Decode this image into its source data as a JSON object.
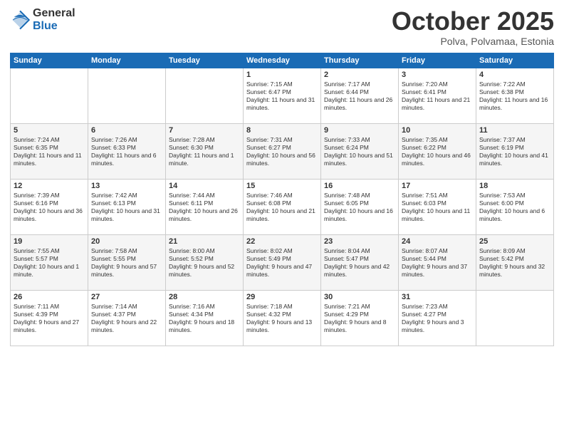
{
  "logo": {
    "general": "General",
    "blue": "Blue"
  },
  "title": "October 2025",
  "location": "Polva, Polvamaa, Estonia",
  "days_of_week": [
    "Sunday",
    "Monday",
    "Tuesday",
    "Wednesday",
    "Thursday",
    "Friday",
    "Saturday"
  ],
  "weeks": [
    [
      {
        "day": "",
        "info": ""
      },
      {
        "day": "",
        "info": ""
      },
      {
        "day": "",
        "info": ""
      },
      {
        "day": "1",
        "sunrise": "Sunrise: 7:15 AM",
        "sunset": "Sunset: 6:47 PM",
        "daylight": "Daylight: 11 hours and 31 minutes."
      },
      {
        "day": "2",
        "sunrise": "Sunrise: 7:17 AM",
        "sunset": "Sunset: 6:44 PM",
        "daylight": "Daylight: 11 hours and 26 minutes."
      },
      {
        "day": "3",
        "sunrise": "Sunrise: 7:20 AM",
        "sunset": "Sunset: 6:41 PM",
        "daylight": "Daylight: 11 hours and 21 minutes."
      },
      {
        "day": "4",
        "sunrise": "Sunrise: 7:22 AM",
        "sunset": "Sunset: 6:38 PM",
        "daylight": "Daylight: 11 hours and 16 minutes."
      }
    ],
    [
      {
        "day": "5",
        "sunrise": "Sunrise: 7:24 AM",
        "sunset": "Sunset: 6:35 PM",
        "daylight": "Daylight: 11 hours and 11 minutes."
      },
      {
        "day": "6",
        "sunrise": "Sunrise: 7:26 AM",
        "sunset": "Sunset: 6:33 PM",
        "daylight": "Daylight: 11 hours and 6 minutes."
      },
      {
        "day": "7",
        "sunrise": "Sunrise: 7:28 AM",
        "sunset": "Sunset: 6:30 PM",
        "daylight": "Daylight: 11 hours and 1 minute."
      },
      {
        "day": "8",
        "sunrise": "Sunrise: 7:31 AM",
        "sunset": "Sunset: 6:27 PM",
        "daylight": "Daylight: 10 hours and 56 minutes."
      },
      {
        "day": "9",
        "sunrise": "Sunrise: 7:33 AM",
        "sunset": "Sunset: 6:24 PM",
        "daylight": "Daylight: 10 hours and 51 minutes."
      },
      {
        "day": "10",
        "sunrise": "Sunrise: 7:35 AM",
        "sunset": "Sunset: 6:22 PM",
        "daylight": "Daylight: 10 hours and 46 minutes."
      },
      {
        "day": "11",
        "sunrise": "Sunrise: 7:37 AM",
        "sunset": "Sunset: 6:19 PM",
        "daylight": "Daylight: 10 hours and 41 minutes."
      }
    ],
    [
      {
        "day": "12",
        "sunrise": "Sunrise: 7:39 AM",
        "sunset": "Sunset: 6:16 PM",
        "daylight": "Daylight: 10 hours and 36 minutes."
      },
      {
        "day": "13",
        "sunrise": "Sunrise: 7:42 AM",
        "sunset": "Sunset: 6:13 PM",
        "daylight": "Daylight: 10 hours and 31 minutes."
      },
      {
        "day": "14",
        "sunrise": "Sunrise: 7:44 AM",
        "sunset": "Sunset: 6:11 PM",
        "daylight": "Daylight: 10 hours and 26 minutes."
      },
      {
        "day": "15",
        "sunrise": "Sunrise: 7:46 AM",
        "sunset": "Sunset: 6:08 PM",
        "daylight": "Daylight: 10 hours and 21 minutes."
      },
      {
        "day": "16",
        "sunrise": "Sunrise: 7:48 AM",
        "sunset": "Sunset: 6:05 PM",
        "daylight": "Daylight: 10 hours and 16 minutes."
      },
      {
        "day": "17",
        "sunrise": "Sunrise: 7:51 AM",
        "sunset": "Sunset: 6:03 PM",
        "daylight": "Daylight: 10 hours and 11 minutes."
      },
      {
        "day": "18",
        "sunrise": "Sunrise: 7:53 AM",
        "sunset": "Sunset: 6:00 PM",
        "daylight": "Daylight: 10 hours and 6 minutes."
      }
    ],
    [
      {
        "day": "19",
        "sunrise": "Sunrise: 7:55 AM",
        "sunset": "Sunset: 5:57 PM",
        "daylight": "Daylight: 10 hours and 1 minute."
      },
      {
        "day": "20",
        "sunrise": "Sunrise: 7:58 AM",
        "sunset": "Sunset: 5:55 PM",
        "daylight": "Daylight: 9 hours and 57 minutes."
      },
      {
        "day": "21",
        "sunrise": "Sunrise: 8:00 AM",
        "sunset": "Sunset: 5:52 PM",
        "daylight": "Daylight: 9 hours and 52 minutes."
      },
      {
        "day": "22",
        "sunrise": "Sunrise: 8:02 AM",
        "sunset": "Sunset: 5:49 PM",
        "daylight": "Daylight: 9 hours and 47 minutes."
      },
      {
        "day": "23",
        "sunrise": "Sunrise: 8:04 AM",
        "sunset": "Sunset: 5:47 PM",
        "daylight": "Daylight: 9 hours and 42 minutes."
      },
      {
        "day": "24",
        "sunrise": "Sunrise: 8:07 AM",
        "sunset": "Sunset: 5:44 PM",
        "daylight": "Daylight: 9 hours and 37 minutes."
      },
      {
        "day": "25",
        "sunrise": "Sunrise: 8:09 AM",
        "sunset": "Sunset: 5:42 PM",
        "daylight": "Daylight: 9 hours and 32 minutes."
      }
    ],
    [
      {
        "day": "26",
        "sunrise": "Sunrise: 7:11 AM",
        "sunset": "Sunset: 4:39 PM",
        "daylight": "Daylight: 9 hours and 27 minutes."
      },
      {
        "day": "27",
        "sunrise": "Sunrise: 7:14 AM",
        "sunset": "Sunset: 4:37 PM",
        "daylight": "Daylight: 9 hours and 22 minutes."
      },
      {
        "day": "28",
        "sunrise": "Sunrise: 7:16 AM",
        "sunset": "Sunset: 4:34 PM",
        "daylight": "Daylight: 9 hours and 18 minutes."
      },
      {
        "day": "29",
        "sunrise": "Sunrise: 7:18 AM",
        "sunset": "Sunset: 4:32 PM",
        "daylight": "Daylight: 9 hours and 13 minutes."
      },
      {
        "day": "30",
        "sunrise": "Sunrise: 7:21 AM",
        "sunset": "Sunset: 4:29 PM",
        "daylight": "Daylight: 9 hours and 8 minutes."
      },
      {
        "day": "31",
        "sunrise": "Sunrise: 7:23 AM",
        "sunset": "Sunset: 4:27 PM",
        "daylight": "Daylight: 9 hours and 3 minutes."
      },
      {
        "day": "",
        "info": ""
      }
    ]
  ]
}
